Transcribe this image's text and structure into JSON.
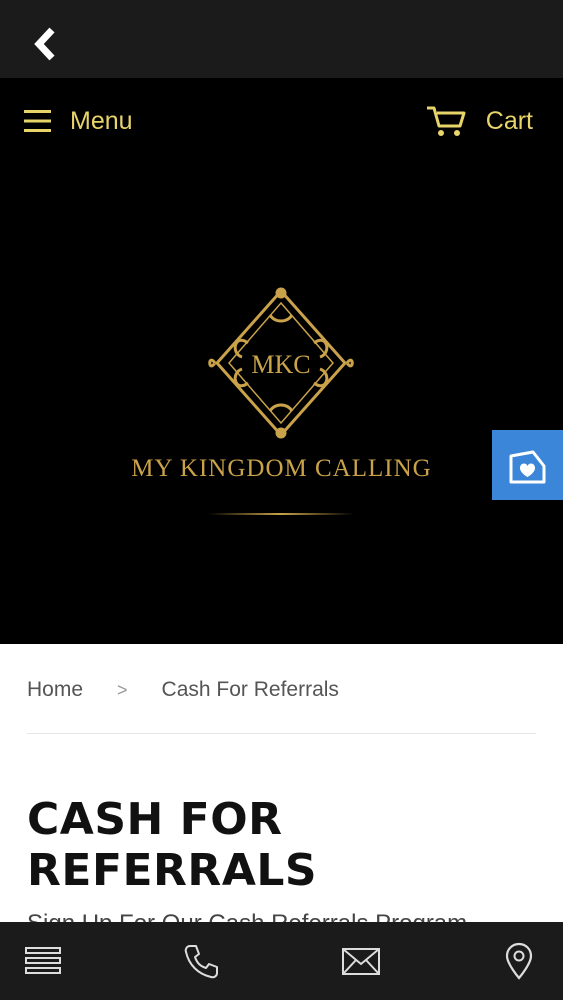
{
  "colors": {
    "accent_gold": "#e8d56a",
    "logo_gold": "#c9a24a",
    "side_tab_blue": "#3b86d9",
    "bar_bg": "#1b1b1b"
  },
  "topbar": {
    "back_icon": "chevron-left-icon"
  },
  "header": {
    "menu_label": "Menu",
    "cart_label": "Cart",
    "menu_icon": "hamburger-icon",
    "cart_icon": "cart-icon"
  },
  "logo": {
    "monogram": "MKC",
    "title": "MY KINGDOM CALLING"
  },
  "side_tab": {
    "icon": "heart-envelope-icon"
  },
  "breadcrumb": {
    "home": "Home",
    "separator": ">",
    "current": "Cash For Referrals"
  },
  "page": {
    "title": "CASH FOR REFERRALS",
    "intro": "Sign Up For Our Cash Referrals Program"
  },
  "bottom_bar": {
    "icons": [
      "list-icon",
      "phone-icon",
      "mail-icon",
      "location-pin-icon"
    ]
  }
}
